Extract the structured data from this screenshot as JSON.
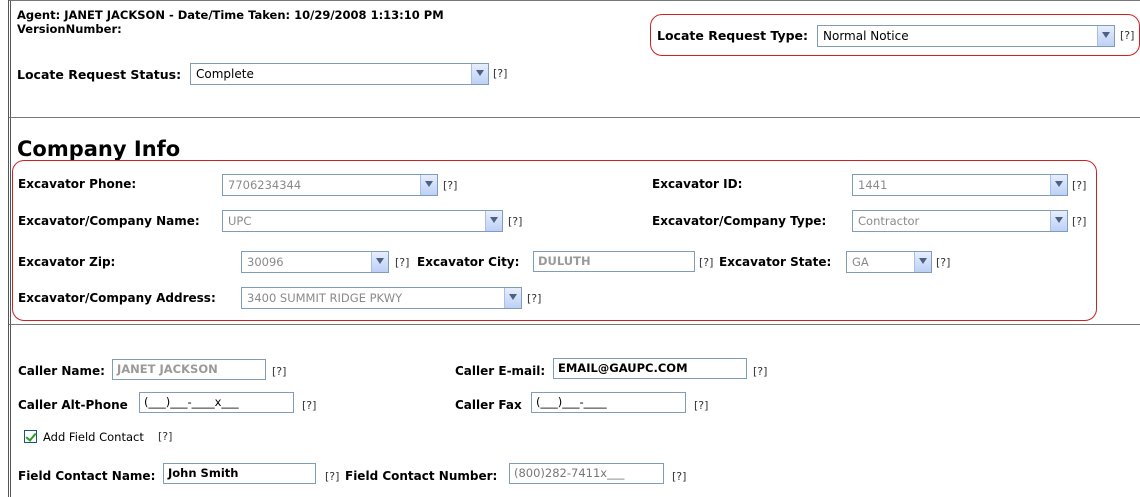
{
  "header": {
    "agent_line": "Agent: JANET JACKSON - Date/Time Taken: 10/29/2008 1:13:10 PM",
    "version_label": "VersionNumber:",
    "locate_request_type_label": "Locate Request Type:",
    "locate_request_type_value": "Normal Notice",
    "locate_request_status_label": "Locate Request Status:",
    "locate_request_status_value": "Complete"
  },
  "help_text": "[?]",
  "company": {
    "title": "Company Info",
    "excavator_phone_label": "Excavator Phone:",
    "excavator_phone_value": "7706234344",
    "excavator_id_label": "Excavator ID:",
    "excavator_id_value": "1441",
    "company_name_label": "Excavator/Company Name:",
    "company_name_value": "UPC",
    "company_type_label": "Excavator/Company Type:",
    "company_type_value": "Contractor",
    "zip_label": "Excavator Zip:",
    "zip_value": "30096",
    "city_label": "Excavator City:",
    "city_value": "DULUTH",
    "state_label": "Excavator State:",
    "state_value": "GA",
    "address_label": "Excavator/Company Address:",
    "address_value": "3400 SUMMIT RIDGE PKWY"
  },
  "caller": {
    "name_label": "Caller Name:",
    "name_value": "JANET JACKSON",
    "email_label": "Caller E-mail:",
    "email_value": "EMAIL@GAUPC.COM",
    "alt_phone_label": "Caller Alt-Phone",
    "alt_phone_value": "(___)___-____x___",
    "fax_label": "Caller Fax",
    "fax_value": "(___)___-____",
    "add_field_contact_label": "Add Field Contact",
    "add_field_contact_checked": true,
    "field_contact_name_label": "Field Contact Name:",
    "field_contact_name_value": "John Smith",
    "field_contact_number_label": "Field Contact Number:",
    "field_contact_number_value": "(800)282-7411x___"
  },
  "colors": {
    "highlight_border": "#cc2222",
    "input_border": "#7f9db9",
    "check_color": "#21a121"
  },
  "icons": [
    "chevron-down-icon",
    "checkmark-icon"
  ]
}
